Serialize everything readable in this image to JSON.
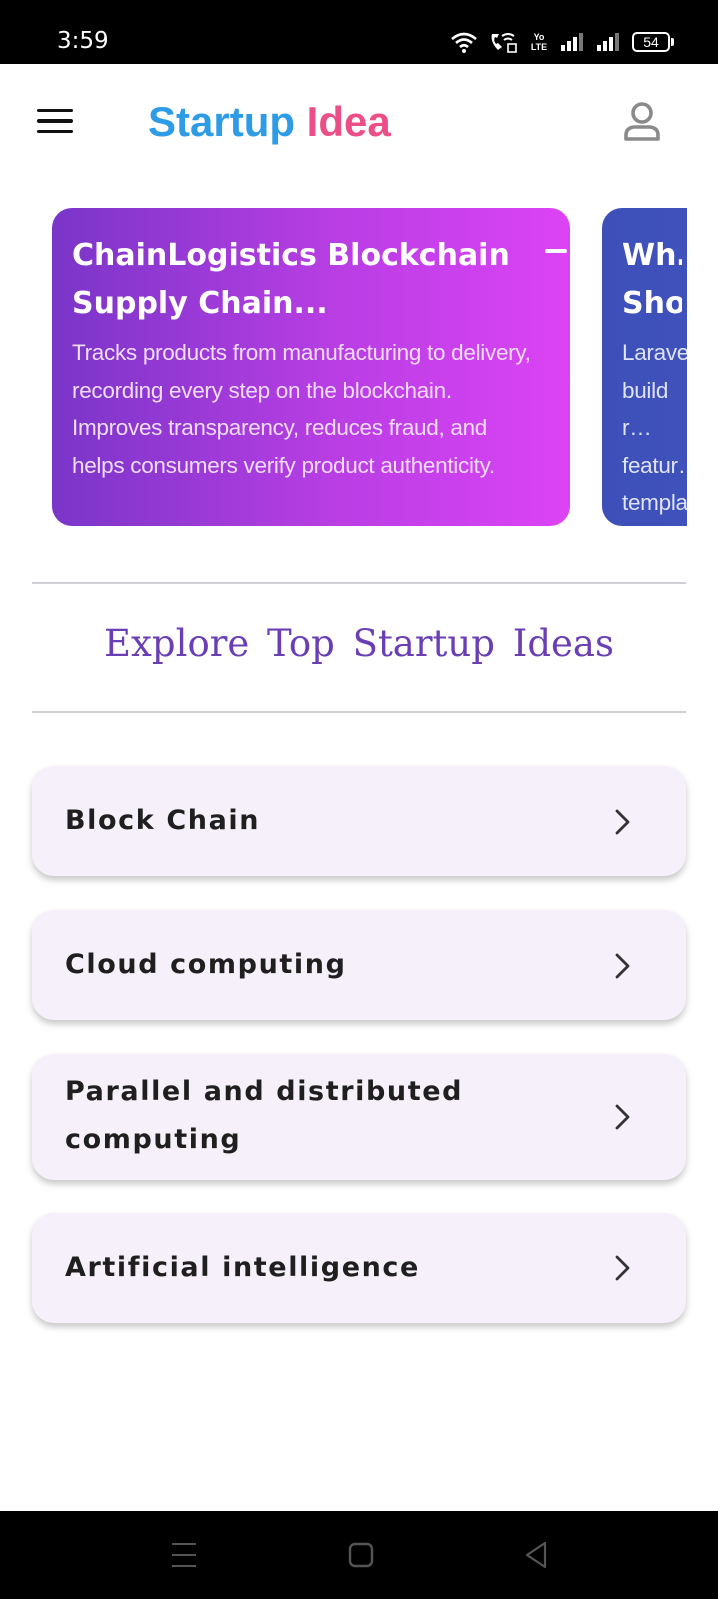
{
  "status_bar": {
    "time": "3:59",
    "lte_label": "Yo LTE",
    "battery": "54"
  },
  "app_bar": {
    "title_part1": "Startup",
    "title_part2": "Idea",
    "title_colors": {
      "part1": "#2e9be6",
      "part2": "#ec4f87"
    },
    "menu_icon": "hamburger-icon",
    "profile_icon": "person-icon"
  },
  "carousel": {
    "cards": [
      {
        "title": "ChainLogistics – Blockchain Supply Chain…",
        "title_display": "ChainLogistics Blockchain Supply Chain...",
        "description": "Tracks products from manufacturing to delivery, recording every step on the blockchain. Improves transparency, reduces fraud, and helps consumers verify product authenticity.",
        "colors": [
          "#7a35c8",
          "#dc43f5"
        ]
      },
      {
        "title": "Wh… Sho…",
        "description": "Larave… build r… featur… templa…",
        "colors": [
          "#3d4fb8",
          "#4c5ccc"
        ]
      }
    ]
  },
  "section": {
    "heading": "Explore Top Startup Ideas",
    "heading_color": "#6a3fb5"
  },
  "categories": [
    {
      "label": "Block Chain"
    },
    {
      "label": "Cloud computing"
    },
    {
      "label": "Parallel and distributed computing"
    },
    {
      "label": "Artificial intelligence"
    }
  ],
  "nav_bar": {
    "icons": [
      "recents-icon",
      "home-icon",
      "back-icon"
    ]
  }
}
